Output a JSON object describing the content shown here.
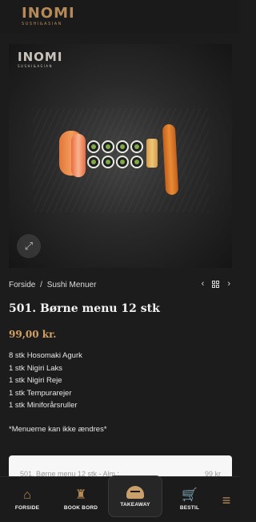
{
  "brand": {
    "name": "INOMI",
    "tagline": "SUSHI&ASIAN"
  },
  "image_overlay": {
    "logo": "INOMI",
    "tagline": "SUSHI&ASIAN"
  },
  "breadcrumb": {
    "home": "Forside",
    "separator": "/",
    "category": "Sushi Menuer"
  },
  "product": {
    "title": "501. Børne menu 12 stk",
    "price": "99,00 kr.",
    "items": [
      "8 stk Hosomaki Agurk",
      "1 stk Nigiri Laks",
      "1 stk Nigiri Reje",
      "1 stk Tempurarejer",
      "1 stk Miniforårsruller"
    ],
    "note": "*Menuerne kan ikke ændres*"
  },
  "order_summary": {
    "label": "501. Børne menu 12 stk - Alm.:",
    "price": "99 kr"
  },
  "nav": {
    "forside": "FORSIDE",
    "book": "BOOK BORD",
    "takeaway": "TAKEAWAY",
    "bestil": "BESTIL"
  },
  "colors": {
    "accent": "#b58a58",
    "price": "#d3a063",
    "background": "#1c1c1c"
  }
}
